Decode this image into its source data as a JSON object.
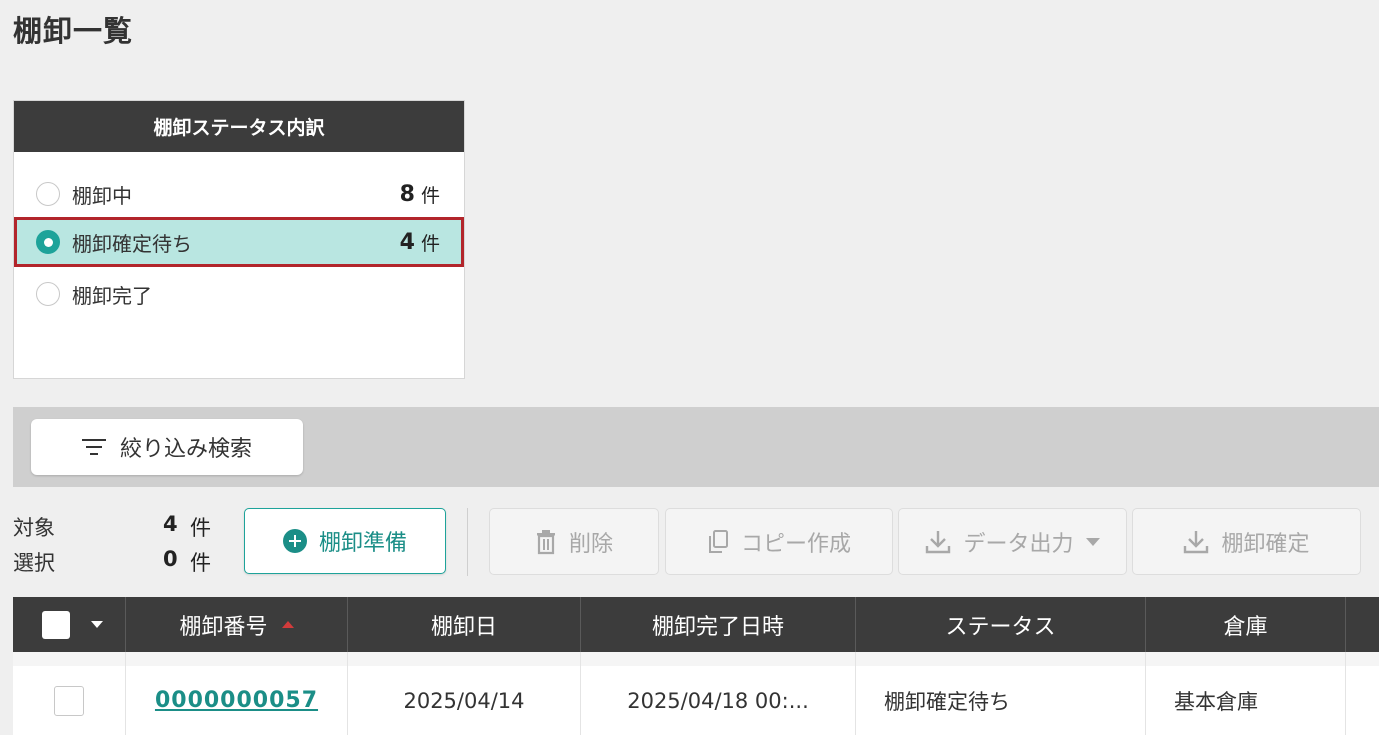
{
  "page": {
    "title": "棚卸一覧"
  },
  "status_panel": {
    "header": "棚卸ステータス内訳",
    "items": [
      {
        "label": "棚卸中",
        "count": "8",
        "unit": "件",
        "selected": false
      },
      {
        "label": "棚卸確定待ち",
        "count": "4",
        "unit": "件",
        "selected": true
      },
      {
        "label": "棚卸完了",
        "count": "",
        "unit": "",
        "selected": false
      }
    ]
  },
  "filter": {
    "label": "絞り込み検索",
    "icon": "filter-icon"
  },
  "counts": {
    "target_label": "対象",
    "target_value": "4",
    "target_unit": "件",
    "selected_label": "選択",
    "selected_value": "0",
    "selected_unit": "件"
  },
  "toolbar": {
    "prepare": "棚卸準備",
    "delete": "削除",
    "copy": "コピー作成",
    "export": "データ出力",
    "confirm": "棚卸確定"
  },
  "table": {
    "columns": [
      "棚卸番号",
      "棚卸日",
      "棚卸完了日時",
      "ステータス",
      "倉庫"
    ],
    "sorted_column": "棚卸番号",
    "sort_direction": "asc",
    "rows": [
      {
        "number": "0000000057",
        "date": "2025/04/14",
        "completed_at": "2025/04/18 00:...",
        "status": "棚卸確定待ち",
        "warehouse": "基本倉庫"
      }
    ]
  },
  "colors": {
    "accent": "#1ea39a",
    "selected_row_bg": "#b9e6e1",
    "highlight_border": "#b2252b",
    "header_bg": "#3c3c3c"
  }
}
